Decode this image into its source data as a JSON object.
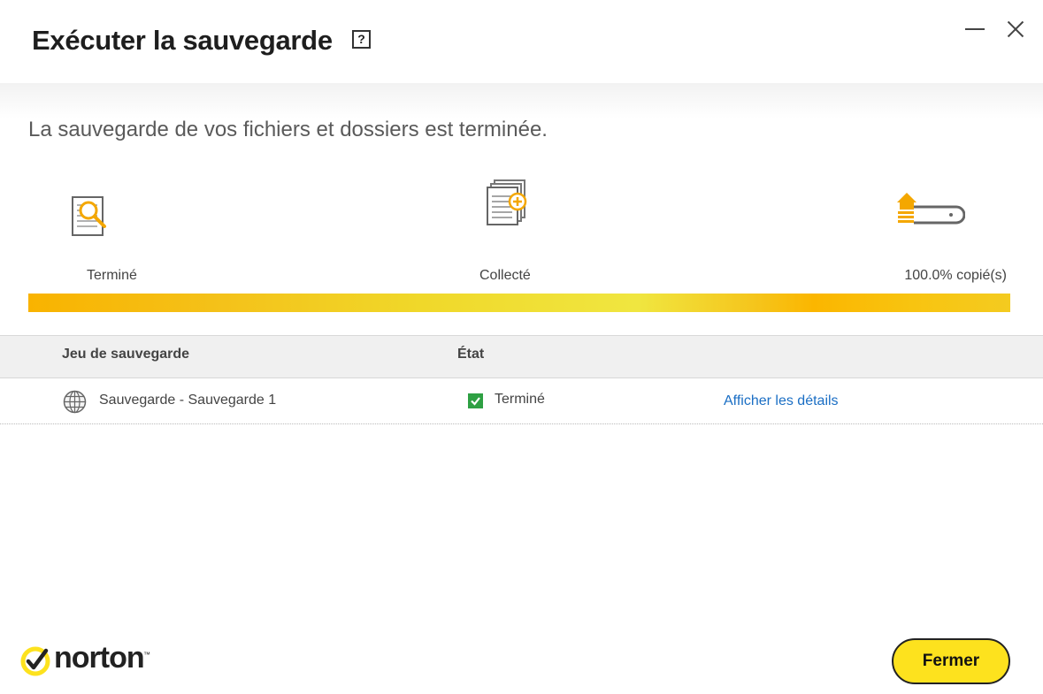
{
  "window": {
    "title": "Exécuter la sauvegarde",
    "help_label": "?"
  },
  "status_message": "La sauvegarde de vos fichiers et dossiers est terminée.",
  "stages": [
    {
      "label": "Terminé",
      "icon": "document-search-icon"
    },
    {
      "label": "Collecté",
      "icon": "file-collect-icon"
    },
    {
      "label": "100.0% copié(s)",
      "icon": "drive-copy-icon"
    }
  ],
  "progress": {
    "percent": 100
  },
  "table": {
    "headers": [
      "Jeu de sauvegarde",
      "État"
    ],
    "rows": [
      {
        "name": "Sauvegarde - Sauvegarde 1",
        "state": "Terminé",
        "link": "Afficher les détails",
        "icon": "globe-icon",
        "state_icon": "check-icon"
      }
    ]
  },
  "brand": {
    "name": "norton",
    "tm": "™",
    "accent": "#fde21e"
  },
  "footer": {
    "close_label": "Fermer"
  }
}
